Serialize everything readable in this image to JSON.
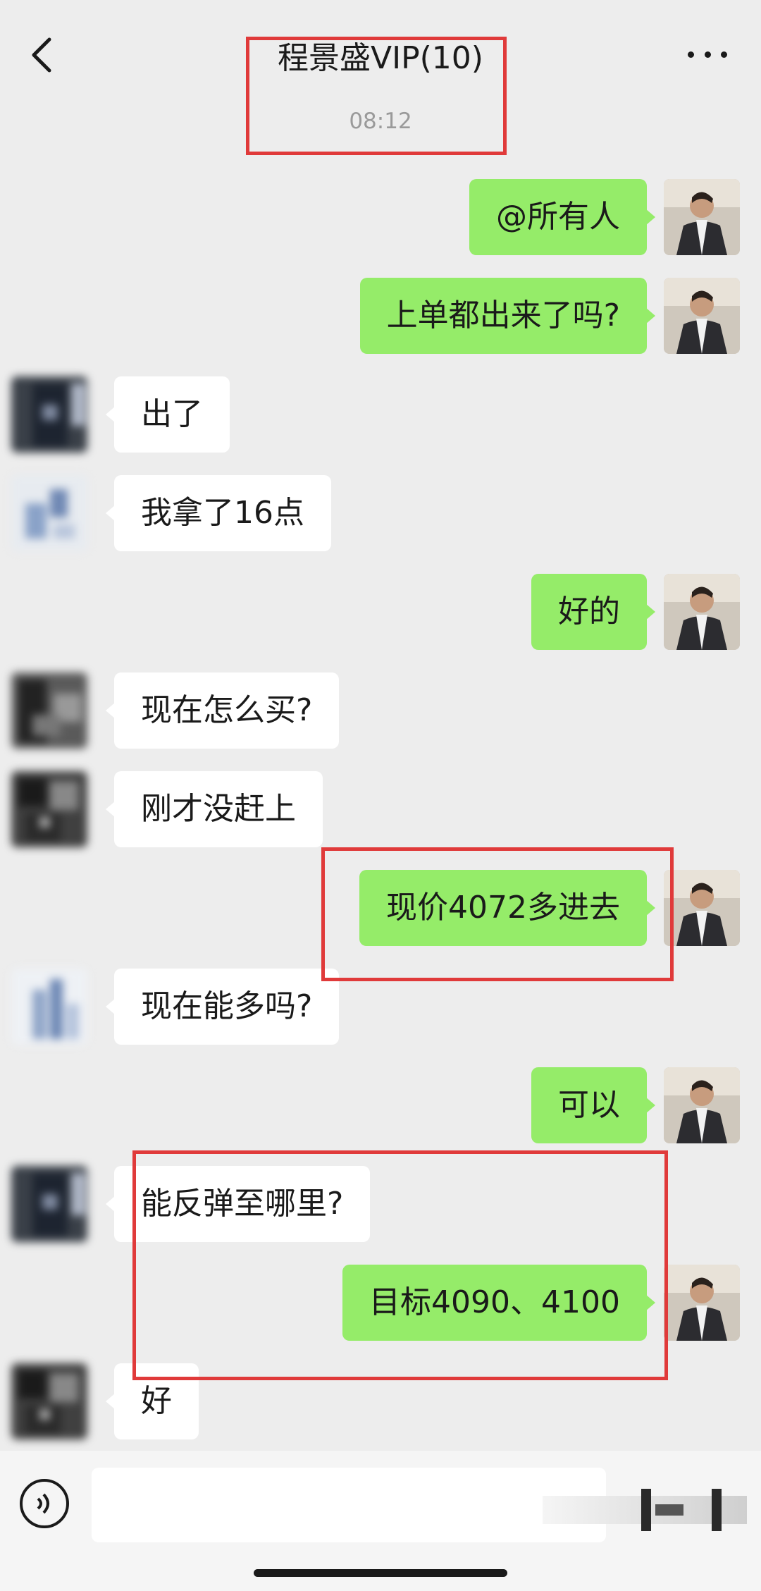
{
  "header": {
    "title": "程景盛VIP(10)",
    "timestamp": "08:12",
    "back_icon": "chevron-left-icon",
    "more_icon": "ellipsis-icon"
  },
  "messages": [
    {
      "sender": "me",
      "text": "@所有人"
    },
    {
      "sender": "me",
      "text": "上单都出来了吗?"
    },
    {
      "sender": "other",
      "text": "出了"
    },
    {
      "sender": "other",
      "text": "我拿了16点"
    },
    {
      "sender": "me",
      "text": "好的"
    },
    {
      "sender": "other",
      "text": "现在怎么买?"
    },
    {
      "sender": "other",
      "text": "刚才没赶上"
    },
    {
      "sender": "me",
      "text": "现价4072多进去"
    },
    {
      "sender": "other",
      "text": "现在能多吗?"
    },
    {
      "sender": "me",
      "text": "可以"
    },
    {
      "sender": "other",
      "text": "能反弹至哪里?"
    },
    {
      "sender": "me",
      "text": "目标4090、4100"
    },
    {
      "sender": "other",
      "text": "好"
    }
  ],
  "input_bar": {
    "voice_icon": "voice-icon",
    "placeholder": ""
  },
  "colors": {
    "background": "#ededed",
    "my_bubble": "#95ec69",
    "other_bubble": "#ffffff",
    "highlight_box": "#e03a3a"
  }
}
